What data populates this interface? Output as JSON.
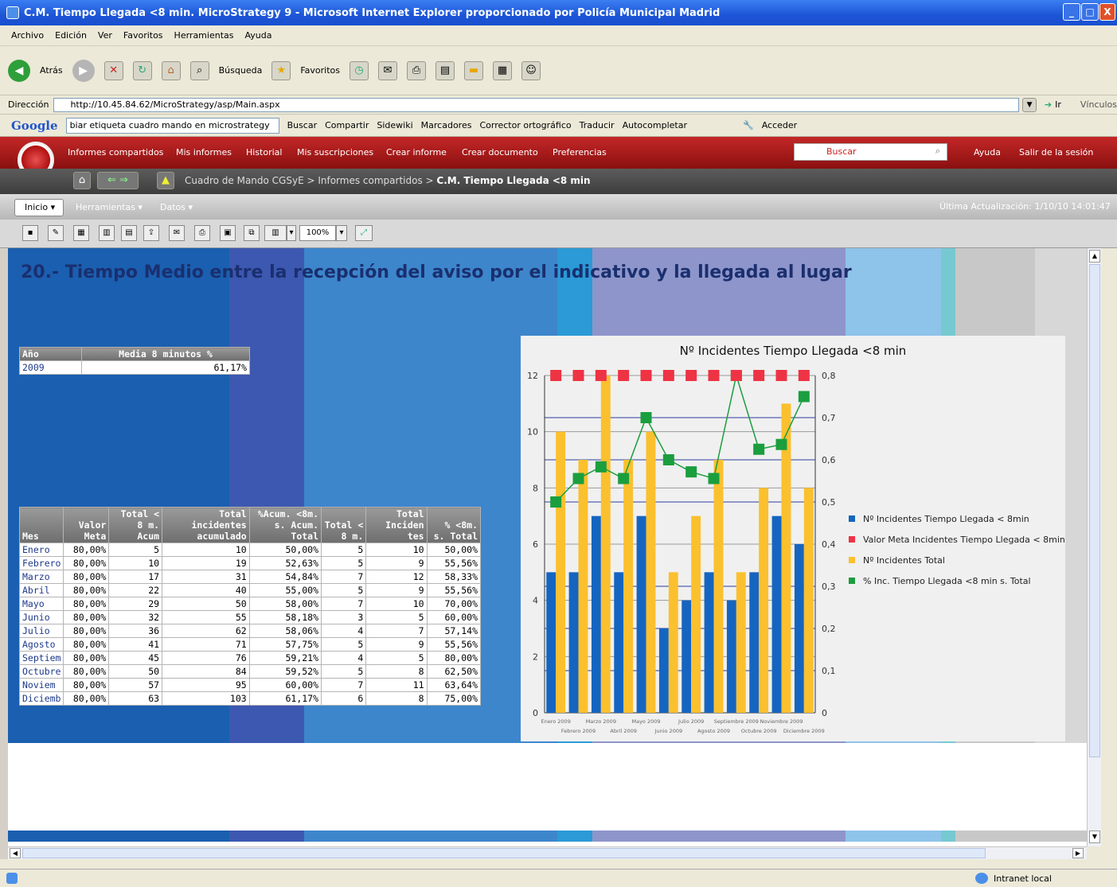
{
  "window": {
    "title": "C.M. Tiempo Llegada <8 min. MicroStrategy 9 - Microsoft Internet Explorer proporcionado por Policía Municipal Madrid",
    "minimize_label": "_",
    "maximize_label": "□",
    "close_label": "X"
  },
  "menu": [
    "Archivo",
    "Edición",
    "Ver",
    "Favoritos",
    "Herramientas",
    "Ayuda"
  ],
  "nav": {
    "back_label": "Atrás",
    "search_label": "Búsqueda",
    "favorites_label": "Favoritos"
  },
  "address": {
    "label": "Dirección",
    "url": "http://10.45.84.62/MicroStrategy/asp/Main.aspx",
    "go_label": "Ir",
    "links_label": "Vínculos"
  },
  "google": {
    "logo": "Google",
    "query": "biar etiqueta cuadro mando en microstrategy",
    "items": [
      "Buscar",
      "Compartir",
      "Sidewiki",
      "Marcadores",
      "Corrector ortográfico",
      "Traducir",
      "Autocompletar"
    ],
    "signin_label": "Acceder"
  },
  "ms": {
    "tabs": [
      "Informes compartidos",
      "Mis informes",
      "Historial",
      "Mis suscripciones",
      "Crear informe",
      "Crear documento",
      "Preferencias"
    ],
    "search_placeholder": "Buscar",
    "help_label": "Ayuda",
    "logout_label": "Salir de la sesión",
    "breadcrumb_path": "Cuadro de Mando CGSyE > Informes compartidos > ",
    "breadcrumb_current": "C.M. Tiempo Llegada <8 min",
    "menu_inicio": "Inicio",
    "menu_herramientas": "Herramientas",
    "menu_datos": "Datos",
    "last_update": "Última Actualización: 1/10/10 14:01:47",
    "zoom": "100%"
  },
  "report": {
    "heading": "20.- Tiempo Medio entre la recepción del aviso por el indicativo y la llegada al lugar",
    "summary": {
      "headers": [
        "Año",
        "Media 8 minutos %"
      ],
      "rows": [
        [
          "2009",
          "61,17%"
        ]
      ]
    },
    "table": {
      "headers": [
        "Mes",
        "Valor Meta",
        "Total < 8 m. Acum",
        "Total incidentes acumulado",
        "%Acum. <8m. s. Acum. Total",
        "Total < 8 m.",
        "Total Inciden tes",
        "% <8m. s. Total"
      ],
      "rows": [
        [
          "Enero",
          "80,00%",
          "5",
          "10",
          "50,00%",
          "5",
          "10",
          "50,00%"
        ],
        [
          "Febrero",
          "80,00%",
          "10",
          "19",
          "52,63%",
          "5",
          "9",
          "55,56%"
        ],
        [
          "Marzo",
          "80,00%",
          "17",
          "31",
          "54,84%",
          "7",
          "12",
          "58,33%"
        ],
        [
          "Abril",
          "80,00%",
          "22",
          "40",
          "55,00%",
          "5",
          "9",
          "55,56%"
        ],
        [
          "Mayo",
          "80,00%",
          "29",
          "50",
          "58,00%",
          "7",
          "10",
          "70,00%"
        ],
        [
          "Junio",
          "80,00%",
          "32",
          "55",
          "58,18%",
          "3",
          "5",
          "60,00%"
        ],
        [
          "Julio",
          "80,00%",
          "36",
          "62",
          "58,06%",
          "4",
          "7",
          "57,14%"
        ],
        [
          "Agosto",
          "80,00%",
          "41",
          "71",
          "57,75%",
          "5",
          "9",
          "55,56%"
        ],
        [
          "Septiem",
          "80,00%",
          "45",
          "76",
          "59,21%",
          "4",
          "5",
          "80,00%"
        ],
        [
          "Octubre",
          "80,00%",
          "50",
          "84",
          "59,52%",
          "5",
          "8",
          "62,50%"
        ],
        [
          "Noviem",
          "80,00%",
          "57",
          "95",
          "60,00%",
          "7",
          "11",
          "63,64%"
        ],
        [
          "Diciemb",
          "80,00%",
          "63",
          "103",
          "61,17%",
          "6",
          "8",
          "75,00%"
        ]
      ]
    }
  },
  "status": {
    "zone": "Intranet local"
  },
  "chart_data": {
    "type": "bar",
    "title": "Nº Incidentes Tiempo Llegada <8 min",
    "categories": [
      "Enero 2009",
      "Febrero 2009",
      "Marzo 2009",
      "Abril 2009",
      "Mayo 2009",
      "Junio 2009",
      "Julio 2009",
      "Agosto 2009",
      "Septiembre 2009",
      "Octubre 2009",
      "Noviembre 2009",
      "Diciembre 2009"
    ],
    "ylim": [
      0,
      12
    ],
    "y_ticks": [
      "0",
      "2",
      "4",
      "6",
      "8",
      "10",
      "12"
    ],
    "y2lim": [
      0,
      0.8
    ],
    "y2_ticks": [
      "0",
      "0,1",
      "0,2",
      "0,3",
      "0,4",
      "0,5",
      "0,6",
      "0,7",
      "0,8"
    ],
    "legend_position": "right",
    "series": [
      {
        "name": "Nº Incidentes Tiempo Llegada < 8min",
        "type": "bar",
        "axis": "left",
        "color": "#1565c0",
        "values": [
          5,
          5,
          7,
          5,
          7,
          3,
          4,
          5,
          4,
          5,
          7,
          6
        ]
      },
      {
        "name": "Valor Meta Incidentes Tiempo Llegada < 8min",
        "type": "marker",
        "axis": "right",
        "color": "#ee3344",
        "values": [
          0.8,
          0.8,
          0.8,
          0.8,
          0.8,
          0.8,
          0.8,
          0.8,
          0.8,
          0.8,
          0.8,
          0.8
        ]
      },
      {
        "name": "Nº Incidentes Total",
        "type": "bar",
        "axis": "left",
        "color": "#fbc02d",
        "values": [
          10,
          9,
          12,
          9,
          10,
          5,
          7,
          9,
          5,
          8,
          11,
          8
        ]
      },
      {
        "name": "% Inc. Tiempo Llegada <8 min s. Total",
        "type": "line",
        "axis": "right",
        "color": "#1b9e3e",
        "values": [
          0.5,
          0.5556,
          0.5833,
          0.5556,
          0.7,
          0.6,
          0.5714,
          0.5556,
          0.8,
          0.625,
          0.6364,
          0.75
        ]
      }
    ]
  }
}
